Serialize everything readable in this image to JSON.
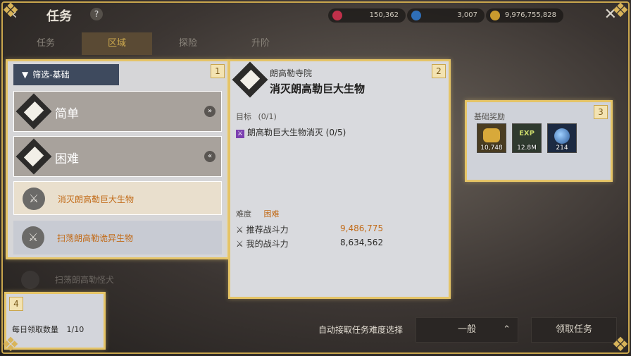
{
  "header": {
    "title": "任务",
    "help": "?",
    "resources": [
      {
        "name": "red-gem",
        "value": "150,362",
        "color": "#c0304a"
      },
      {
        "name": "blue-gem",
        "value": "3,007",
        "color": "#2f6fb8"
      },
      {
        "name": "gold",
        "value": "9,976,755,828",
        "color": "#c99a2e"
      }
    ],
    "tabs": [
      "任务",
      "区域",
      "探险",
      "升阶"
    ],
    "active_tab": "区域"
  },
  "panel1": {
    "number": "1",
    "filter_label": "筛选-基础",
    "categories": [
      {
        "label": "简单",
        "arrow": "»"
      },
      {
        "label": "困难",
        "arrow": "«"
      }
    ],
    "quests": [
      {
        "label": "消灭朗高勒巨大生物"
      },
      {
        "label": "扫荡朗高勒诡异生物"
      }
    ],
    "hidden_quest": "扫荡朗高勒怪犬"
  },
  "panel2": {
    "number": "2",
    "location": "朗高勒寺院",
    "name": "消灭朗高勒巨大生物",
    "objective_label": "目标",
    "objective_count": "(0/1)",
    "objective_item": "朗高勒巨大生物消灭 (0/5)",
    "difficulty_label": "难度",
    "difficulty_value": "困难",
    "recommend_label": "推荐战斗力",
    "recommend_value": "9,486,775",
    "mine_label": "我的战斗力",
    "mine_value": "8,634,562"
  },
  "panel3": {
    "number": "3",
    "title": "基础奖励",
    "rewards": [
      {
        "name": "gold-coins-icon",
        "count": "10,748"
      },
      {
        "name": "exp-icon",
        "count": "12.8M",
        "text": "EXP"
      },
      {
        "name": "orb-icon",
        "count": "214"
      }
    ]
  },
  "panel4": {
    "number": "4",
    "label": "每日领取数量",
    "value": "1/10"
  },
  "footer": {
    "auto_label": "自动接取任务难度选择",
    "select_value": "一般",
    "accept_button": "领取任务"
  }
}
